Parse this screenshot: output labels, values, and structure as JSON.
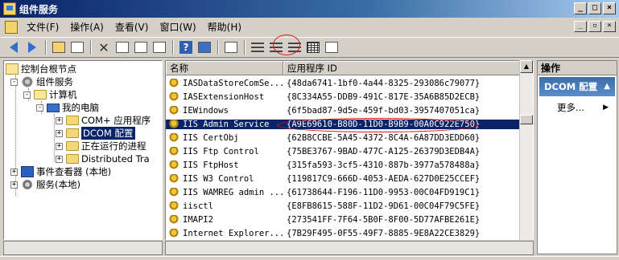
{
  "window": {
    "title": "组件服务"
  },
  "menu": [
    "文件(F)",
    "操作(A)",
    "查看(V)",
    "窗口(W)",
    "帮助(H)"
  ],
  "window_buttons": [
    "_",
    "□",
    "×"
  ],
  "mdi_buttons": [
    "_",
    "▫",
    "×"
  ],
  "toolbar": {
    "buttons": [
      "back-icon",
      "forward-icon",
      "up-icon",
      "show-hide-tree-icon",
      "delete-icon",
      "properties-icon",
      "refresh-icon",
      "export-list-icon",
      "help-icon",
      "show-hide-action-icon",
      "details-view-icon",
      "large-icons-icon",
      "small-icons-icon",
      "list-view-icon",
      "status-view-icon",
      "new-window-icon"
    ]
  },
  "tree": {
    "nodes": [
      {
        "label": "控制台根节点",
        "level": 0,
        "icon": "root-icon"
      },
      {
        "label": "组件服务",
        "level": 1,
        "icon": "gear-icon"
      },
      {
        "label": "计算机",
        "level": 2,
        "icon": "folder-icon"
      },
      {
        "label": "我的电脑",
        "level": 3,
        "icon": "computer-icon"
      },
      {
        "label": "COM+ 应用程序",
        "level": 4,
        "icon": "folder-icon"
      },
      {
        "label": "DCOM 配置",
        "level": 4,
        "icon": "folder-icon",
        "selected": true
      },
      {
        "label": "正在运行的进程",
        "level": 4,
        "icon": "folder-icon"
      },
      {
        "label": "Distributed Tra",
        "level": 4,
        "icon": "folder-icon"
      },
      {
        "label": "事件查看器 (本地)",
        "level": 0,
        "icon": "event-viewer-icon"
      },
      {
        "label": "服务(本地)",
        "level": 0,
        "icon": "services-icon"
      }
    ]
  },
  "list": {
    "columns": [
      "名称",
      "应用程序 ID"
    ],
    "rows": [
      {
        "name": "IASDataStoreComSe...",
        "appid": "{48da6741-1bf0-4a44-8325-293086c79077}"
      },
      {
        "name": "IASExtensionHost",
        "appid": "{8C334A55-DDB9-491C-817E-35A6B85D2ECB}"
      },
      {
        "name": "IEWindows",
        "appid": "{6f5bad87-9d5e-459f-bd03-3957407051ca}"
      },
      {
        "name": "IIS Admin Service",
        "appid": "{A9E69610-B80D-11D0-B9B9-00A0C922E750}",
        "selected": true
      },
      {
        "name": "IIS CertObj",
        "appid": "{62B8CCBE-5A45-4372-8C4A-6A87DD3EDD60}"
      },
      {
        "name": "IIS Ftp Control",
        "appid": "{75BE3767-9BAD-477C-A125-26379D3EDB4A}"
      },
      {
        "name": "IIS FtpHost",
        "appid": "{315fa593-3cf5-4310-887b-3977a578488a}"
      },
      {
        "name": "IIS W3 Control",
        "appid": "{119817C9-666D-4053-AEDA-627D0E25CCEF}"
      },
      {
        "name": "IIS WAMREG admin ...",
        "appid": "{61738644-F196-11D0-9953-00C04FD919C1}"
      },
      {
        "name": "iisctl",
        "appid": "{E8FB8615-588F-11D2-9D61-00C04F79C5FE}"
      },
      {
        "name": "IMAPI2",
        "appid": "{273541FF-7F64-5B0F-8F00-5D77AFBE261E}"
      },
      {
        "name": "Internet Explorer...",
        "appid": "{7B29F495-0F55-49F7-8885-9E8A22CE3829}"
      }
    ]
  },
  "actions": {
    "title": "操作",
    "section": "DCOM 配置",
    "items": [
      "更多..."
    ]
  }
}
